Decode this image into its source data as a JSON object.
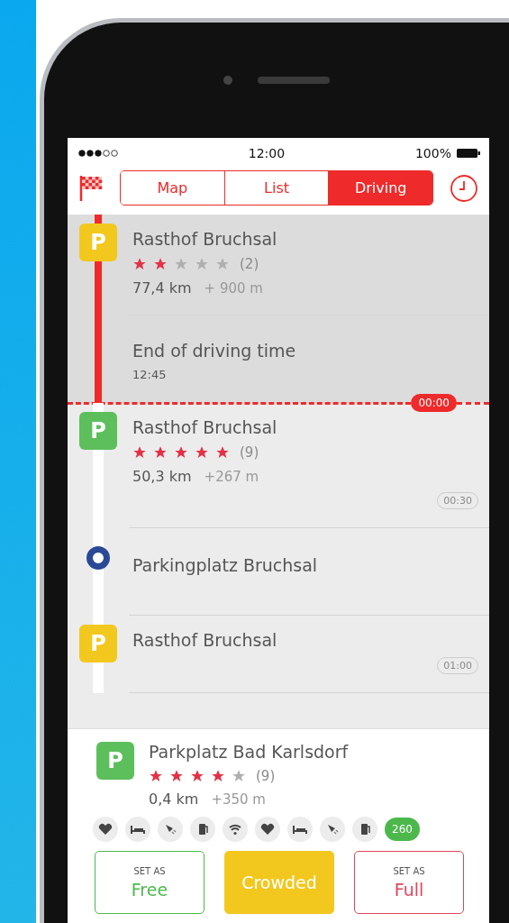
{
  "status_bar": {
    "time": "12:00",
    "battery": "100%"
  },
  "tabs": [
    {
      "label": "Map",
      "selected": false
    },
    {
      "label": "List",
      "selected": false
    },
    {
      "label": "Driving",
      "selected": true
    }
  ],
  "timeline": [
    {
      "kind": "stop",
      "past": true,
      "color": "#f2c81e",
      "marker": "P",
      "title": "Rasthof Bruchsal",
      "stars": 2,
      "count": "(2)",
      "distance": "77,4 km",
      "elevation": "+ 900 m"
    },
    {
      "kind": "event",
      "past": true,
      "title": "End of driving time",
      "time": "12:45"
    },
    {
      "kind": "divider",
      "badge": "00:00"
    },
    {
      "kind": "stop",
      "past": false,
      "color": "#5cbf5c",
      "marker": "P",
      "title": "Rasthof Bruchsal",
      "stars": 5,
      "count": "(9)",
      "distance": "50,3 km",
      "elevation": "+267 m",
      "badge": "00:30"
    },
    {
      "kind": "waypoint",
      "past": false,
      "title": "Parkingplatz Bruchsal"
    },
    {
      "kind": "stop",
      "past": false,
      "color": "#f2c81e",
      "marker": "P",
      "title": "Rasthof Bruchsal",
      "badge": "01:00"
    }
  ],
  "detail": {
    "marker": "P",
    "title": "Parkplatz Bad Karlsdorf",
    "stars": 4,
    "count": "(9)",
    "distance": "0,4 km",
    "elevation": "+350 m",
    "amenities": [
      {
        "kind": "heart"
      },
      {
        "kind": "bed"
      },
      {
        "kind": "shower"
      },
      {
        "kind": "fuel"
      },
      {
        "kind": "wifi"
      },
      {
        "kind": "heart"
      },
      {
        "kind": "bed"
      },
      {
        "kind": "shower"
      },
      {
        "kind": "fuel"
      }
    ],
    "spaces": "260",
    "buttons": [
      {
        "kind": "free",
        "caption": "SET AS",
        "label": "Free",
        "selected": false
      },
      {
        "kind": "crowded",
        "label": "Crowded",
        "selected": true
      },
      {
        "kind": "full",
        "caption": "SET AS",
        "label": "Full",
        "selected": false
      }
    ]
  }
}
